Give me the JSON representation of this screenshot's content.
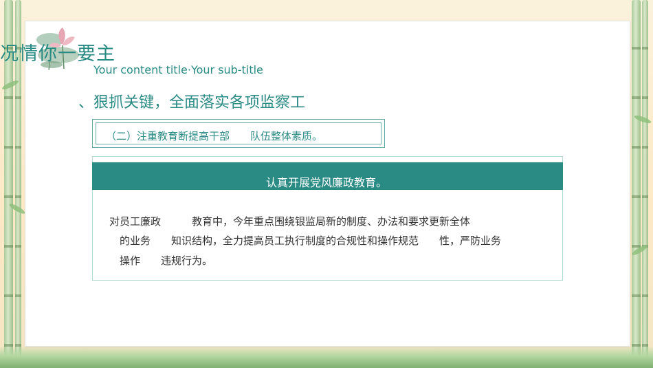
{
  "heading": {
    "title": "况情你一要主",
    "subtitle": "Your content title·Your sub-title"
  },
  "section": {
    "title": "、狠抓关键，全面落实各项监察工",
    "sub_item": "（二）注重教育断提高干部　　队伍整体素质。"
  },
  "content": {
    "banner": "认真开展党风廉政教育。",
    "lines": [
      "对员工廉政　　　教育中，今年重点围绕银监局新的制度、办法和要求更新全体",
      "的业务　　知识结构，全力提高员工执行制度的合规性和操作规范　　性，严防业务",
      "操作　　违规行为。"
    ]
  },
  "colors": {
    "accent": "#2a8a84",
    "banner_bg": "#2a8a84",
    "text_dark": "#333333"
  },
  "icons": {
    "logo": "lotus-icon"
  }
}
